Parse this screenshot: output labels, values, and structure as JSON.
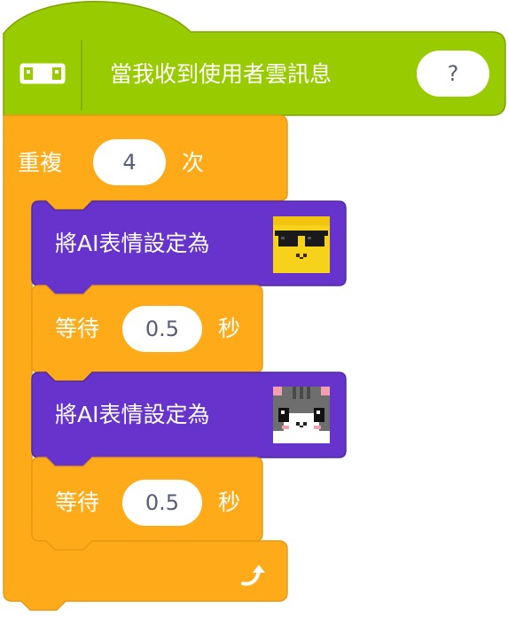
{
  "hat": {
    "label": "當我收到使用者雲訊息",
    "input": "?"
  },
  "repeat": {
    "prefix": "重複",
    "count": "4",
    "suffix": "次"
  },
  "stack": [
    {
      "type": "set-face",
      "label": "將AI表情設定為",
      "face": "sunglasses-face-icon"
    },
    {
      "type": "wait",
      "prefix": "等待",
      "value": "0.5",
      "suffix": "秒"
    },
    {
      "type": "set-face",
      "label": "將AI表情設定為",
      "face": "cat-face-icon"
    },
    {
      "type": "wait",
      "prefix": "等待",
      "value": "0.5",
      "suffix": "秒"
    }
  ],
  "colors": {
    "event": "#99cc00",
    "event_border": "#7ea300",
    "control": "#ffab19",
    "control_border": "#e59a16",
    "ai": "#6633cc",
    "ai_border": "#52299e",
    "input_text": "#575e75"
  }
}
